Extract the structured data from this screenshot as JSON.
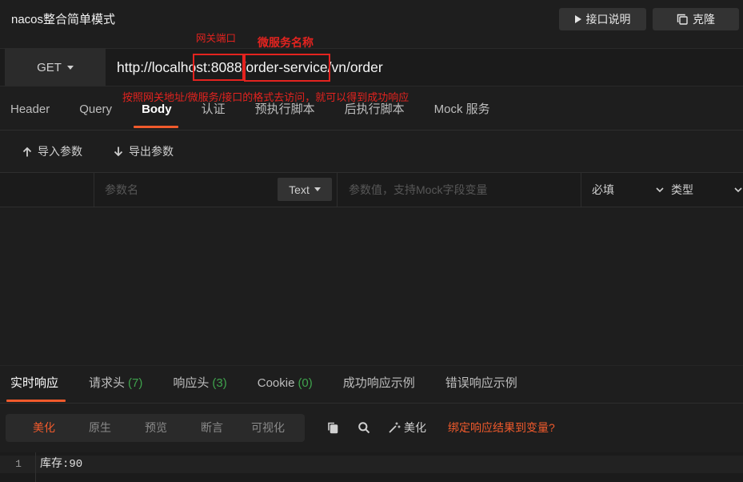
{
  "header": {
    "title": "nacos整合简单模式",
    "doc_button": {
      "icon": "play-icon",
      "label": "接口说明"
    },
    "clone_button": {
      "icon": "copy-icon",
      "label": "克隆"
    }
  },
  "annotations": {
    "gateway_port": "网关端口",
    "service_name": "微服务名称",
    "hint": "按照网关地址/微服务/接口的格式去访问，就可以得到成功响应"
  },
  "request": {
    "method": "GET",
    "url": "http://localhost:8088/order-service/vn/order"
  },
  "request_tabs": [
    {
      "label": "Header"
    },
    {
      "label": "Query"
    },
    {
      "label": "Body",
      "active": true
    },
    {
      "label": "认证"
    },
    {
      "label": "预执行脚本"
    },
    {
      "label": "后执行脚本"
    },
    {
      "label": "Mock 服务"
    }
  ],
  "params_toolbar": {
    "import": {
      "icon": "arrow-up-icon",
      "label": "导入参数"
    },
    "export": {
      "icon": "arrow-down-icon",
      "label": "导出参数"
    }
  },
  "param_row": {
    "name_placeholder": "参数名",
    "field_type": "Text",
    "value_placeholder": "参数值，支持Mock字段变量",
    "required_label": "必填",
    "type_label": "类型"
  },
  "response_tabs": [
    {
      "label": "实时响应",
      "active": true
    },
    {
      "label": "请求头",
      "count": "(7)"
    },
    {
      "label": "响应头",
      "count": "(3)"
    },
    {
      "label": "Cookie",
      "count": "(0)"
    },
    {
      "label": "成功响应示例"
    },
    {
      "label": "错误响应示例"
    }
  ],
  "view_modes": [
    {
      "label": "美化",
      "active": true
    },
    {
      "label": "原生"
    },
    {
      "label": "预览"
    },
    {
      "label": "断言"
    },
    {
      "label": "可视化"
    }
  ],
  "response_toolbar": {
    "copy_icon": "clipboard-icon",
    "search_icon": "search-icon",
    "beautify": {
      "icon": "magic-wand-icon",
      "label": "美化"
    },
    "bind_variable": "绑定响应结果到变量?"
  },
  "response_body": {
    "lines": [
      {
        "number": "1",
        "text": "库存:90"
      }
    ]
  },
  "colors": {
    "background": "#1e1e1e",
    "accent": "#f05a2c",
    "annotation": "#e3231f",
    "count": "#3fa34d"
  }
}
